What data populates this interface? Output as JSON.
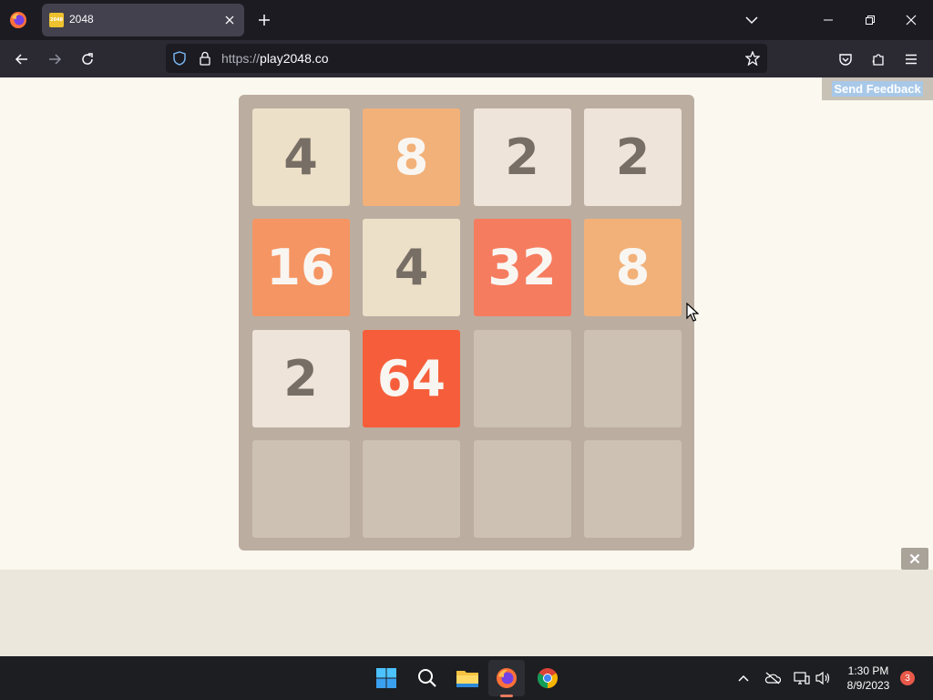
{
  "browser": {
    "tab": {
      "favicon_text": "2048",
      "title": "2048"
    },
    "url": {
      "scheme": "https://",
      "host": "play2048.co"
    }
  },
  "page": {
    "feedback_label": "Send Feedback",
    "board": {
      "size": 4,
      "tiles": [
        [
          4,
          8,
          2,
          2
        ],
        [
          16,
          4,
          32,
          8
        ],
        [
          2,
          64,
          null,
          null
        ],
        [
          null,
          null,
          null,
          null
        ]
      ]
    },
    "tile_colors": {
      "2": {
        "bg": "#eee4da",
        "fg": "#776e65"
      },
      "4": {
        "bg": "#ede0c8",
        "fg": "#776e65"
      },
      "8": {
        "bg": "#f2b179",
        "fg": "#f9f6f2"
      },
      "16": {
        "bg": "#f59563",
        "fg": "#f9f6f2"
      },
      "32": {
        "bg": "#f67c5f",
        "fg": "#f9f6f2"
      },
      "64": {
        "bg": "#f65e3b",
        "fg": "#f9f6f2"
      },
      "empty": {
        "bg": "#cdc1b4"
      }
    }
  },
  "taskbar": {
    "time": "1:30 PM",
    "date": "8/9/2023",
    "notification_count": "3",
    "pinned": [
      "windows-start-icon",
      "search-icon",
      "file-explorer-icon",
      "firefox-icon",
      "chrome-icon"
    ],
    "tray": [
      "chevron-up-icon",
      "onedrive-offline-icon",
      "network-icon",
      "volume-icon"
    ]
  }
}
